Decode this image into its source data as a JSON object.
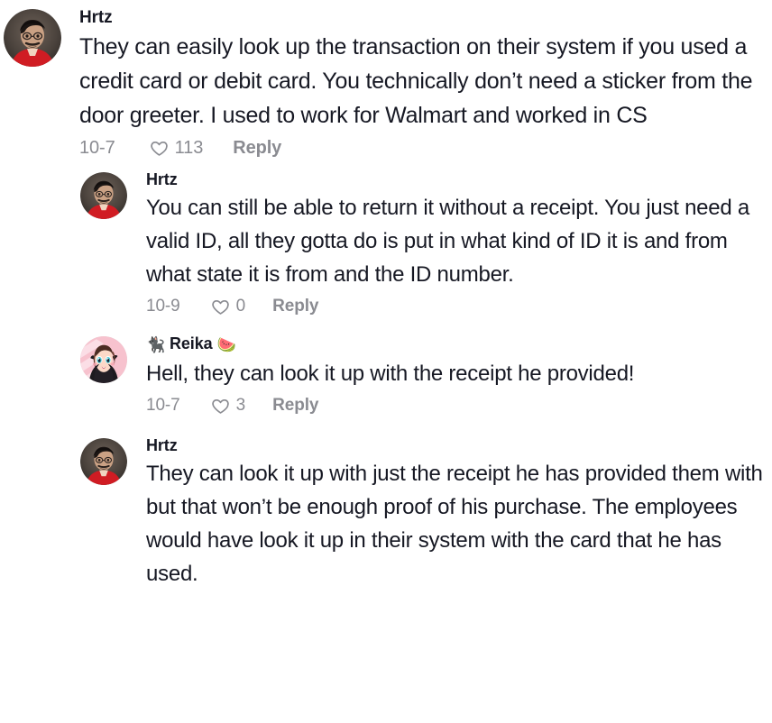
{
  "thread": {
    "comments": [
      {
        "id": "comment-1",
        "level": "top-level",
        "username": "Hrtz",
        "username_prefix_emoji": "",
        "username_suffix_emoji": "",
        "avatar": "photo-man-red-shirt",
        "text": "They can easily look up the transaction on their system if you used a credit card or debit card. You technically don’t need a sticker from the door greeter. I used to work for Walmart and worked in CS",
        "date": "10-7",
        "like_icon": "heart-icon",
        "likes": "113",
        "reply_label": "Reply"
      },
      {
        "id": "comment-2",
        "level": "reply",
        "username": "Hrtz",
        "username_prefix_emoji": "",
        "username_suffix_emoji": "",
        "avatar": "photo-man-red-shirt",
        "text": "You can still be able to return it without a receipt. You just need a valid ID, all they gotta do is put in what kind of ID it is and from what state it is from and the ID number.",
        "date": "10-9",
        "like_icon": "heart-icon",
        "likes": "0",
        "reply_label": "Reply"
      },
      {
        "id": "comment-3",
        "level": "reply",
        "username": "Reika",
        "username_prefix_emoji": "🐈‍⬛",
        "username_suffix_emoji": "🍉",
        "avatar": "anime-girl-pink-hoodie",
        "text": "Hell, they can look it up with the receipt he provided!",
        "date": "10-7",
        "like_icon": "heart-icon",
        "likes": "3",
        "reply_label": "Reply"
      },
      {
        "id": "comment-4",
        "level": "reply",
        "username": "Hrtz",
        "username_prefix_emoji": "",
        "username_suffix_emoji": "",
        "avatar": "photo-man-red-shirt",
        "text": "They can look it up with just the receipt he has provided them with but that won’t be enough proof of his purchase. The employees would have look it up in their system with the card that he has used.",
        "date": "",
        "like_icon": "",
        "likes": "",
        "reply_label": ""
      }
    ],
    "colors": {
      "text": "#161823",
      "meta": "#8a8b91",
      "background": "#ffffff"
    }
  }
}
